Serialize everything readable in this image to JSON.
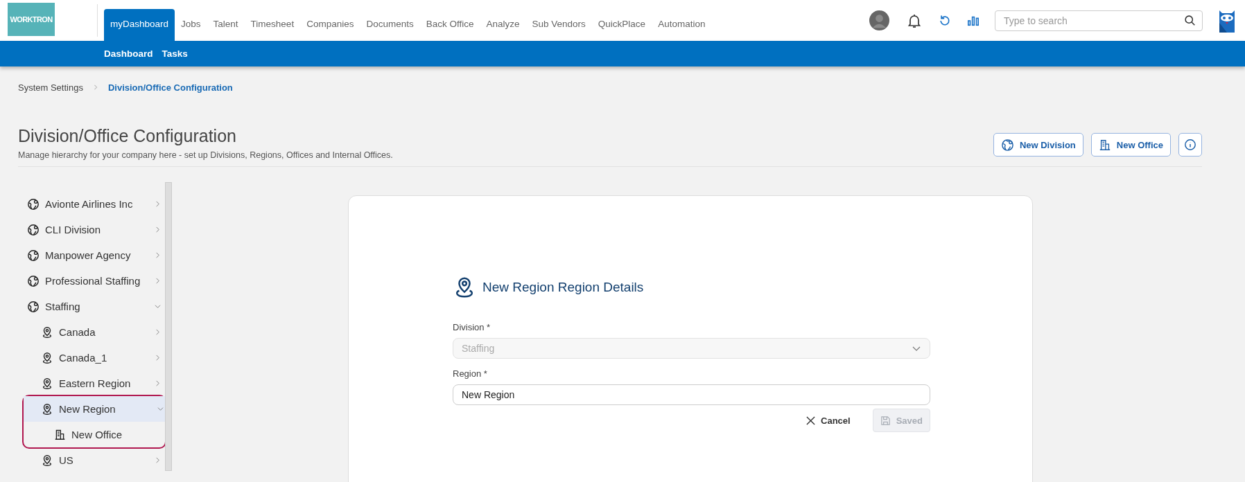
{
  "logo": {
    "text": "WORKTRON"
  },
  "nav": [
    {
      "label": "myDashboard",
      "selected": true
    },
    {
      "label": "Jobs",
      "selected": false
    },
    {
      "label": "Talent",
      "selected": false
    },
    {
      "label": "Timesheet",
      "selected": false
    },
    {
      "label": "Companies",
      "selected": false
    },
    {
      "label": "Documents",
      "selected": false
    },
    {
      "label": "Back Office",
      "selected": false
    },
    {
      "label": "Analyze",
      "selected": false
    },
    {
      "label": "Sub Vendors",
      "selected": false
    },
    {
      "label": "QuickPlace",
      "selected": false
    },
    {
      "label": "Automation",
      "selected": false
    }
  ],
  "subnav": [
    "Dashboard",
    "Tasks"
  ],
  "search": {
    "placeholder": "Type to search"
  },
  "breadcrumb": [
    "System Settings",
    "Division/Office Configuration"
  ],
  "page": {
    "title": "Division/Office Configuration",
    "subtitle": "Manage hierarchy for your company here - set up Divisions, Regions, Offices and Internal Offices."
  },
  "actions": [
    {
      "kind": "division",
      "label": "New Division"
    },
    {
      "kind": "office",
      "label": "New Office"
    },
    {
      "kind": "info"
    }
  ],
  "tree": [
    {
      "label": "Avionte Airlines Inc",
      "kind": "division",
      "expanded": false,
      "selected": false
    },
    {
      "label": "CLI Division",
      "kind": "division",
      "expanded": false,
      "selected": false
    },
    {
      "label": "Manpower Agency",
      "kind": "division",
      "expanded": false,
      "selected": false
    },
    {
      "label": "Professional Staffing",
      "kind": "division",
      "expanded": false,
      "selected": false
    },
    {
      "label": "Staffing",
      "kind": "division",
      "expanded": true,
      "selected": false,
      "children": [
        {
          "label": "Canada",
          "kind": "region",
          "expanded": false,
          "selected": false
        },
        {
          "label": "Canada_1",
          "kind": "region",
          "expanded": false,
          "selected": false
        },
        {
          "label": "Eastern Region",
          "kind": "region",
          "expanded": false,
          "selected": false
        },
        {
          "label": "New Region",
          "kind": "region",
          "expanded": true,
          "selected": true,
          "children": [
            {
              "label": "New Office",
              "kind": "office",
              "selected": false
            }
          ]
        },
        {
          "label": "US",
          "kind": "region",
          "expanded": false,
          "selected": false
        }
      ]
    }
  ],
  "form": {
    "title": "New Region Region Details",
    "fields": [
      {
        "label": "Division *",
        "kind": "select",
        "value": "Staffing",
        "disabled": true
      },
      {
        "label": "Region *",
        "kind": "text",
        "value": "New Region",
        "disabled": false
      }
    ],
    "buttons": [
      {
        "kind": "cancel",
        "label": "Cancel",
        "disabled": false
      },
      {
        "kind": "save",
        "label": "Saved",
        "disabled": true
      }
    ]
  }
}
